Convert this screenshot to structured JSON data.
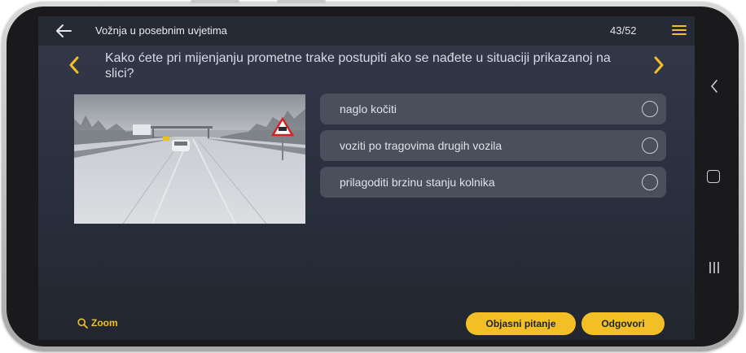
{
  "header": {
    "title": "Vožnja u posebnim uvjetima",
    "counter": "43/52"
  },
  "question": {
    "text": "Kako ćete pri mijenjanju prometne trake postupiti ako se nađete  u situaciji prikazanoj na slici?"
  },
  "answers": [
    {
      "label": "naglo kočiti",
      "selected": false
    },
    {
      "label": "voziti po tragovima drugih vozila",
      "selected": false
    },
    {
      "label": "prilagoditi brzinu stanju kolnika",
      "selected": false
    }
  ],
  "footer": {
    "zoom_label": "Zoom",
    "explain_label": "Objasni pitanje",
    "answer_label": "Odgovori"
  },
  "icons": {
    "back": "arrow-left-icon",
    "menu": "hamburger-menu-icon",
    "prev": "chevron-left-icon",
    "next": "chevron-right-icon",
    "zoom": "search-icon",
    "radio": "radio-circle-icon",
    "nav_back": "nav-back-icon",
    "nav_home": "nav-home-icon",
    "nav_recent": "nav-recent-apps-icon"
  },
  "colors": {
    "accent": "#f2c026",
    "screen_bg": "#2a2f3e",
    "answer_bg": "#4a4f5c"
  }
}
